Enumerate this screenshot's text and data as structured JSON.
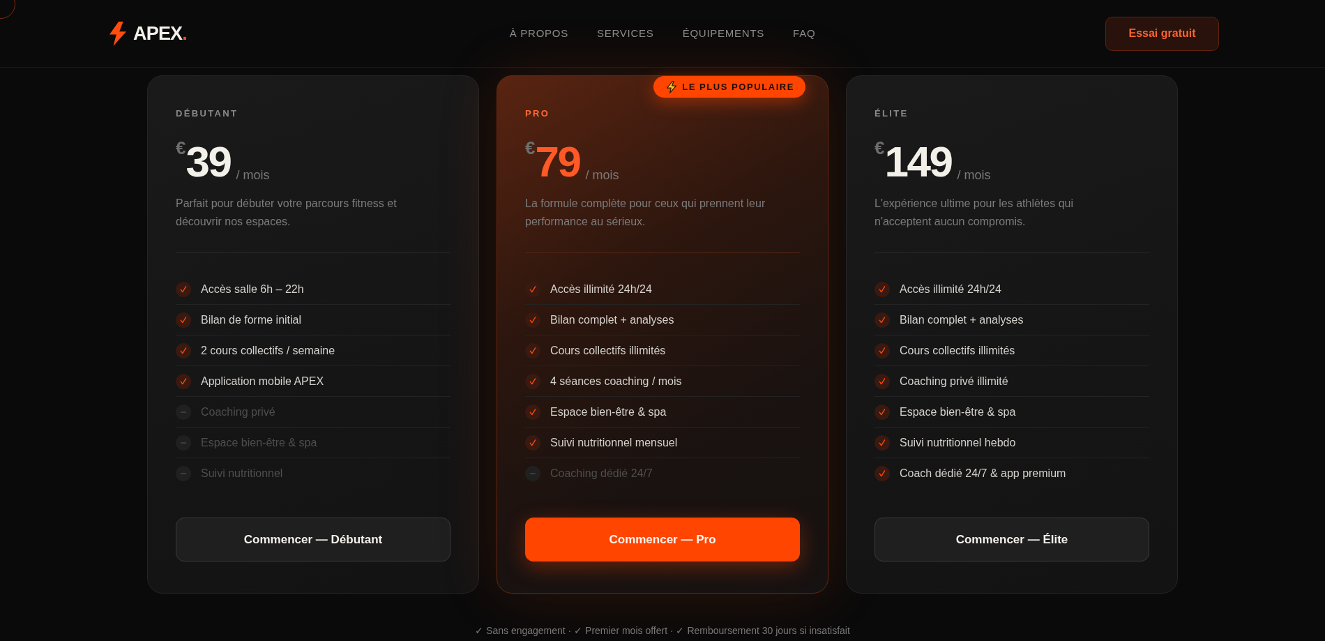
{
  "header": {
    "logo": {
      "name": "APEX",
      "mark": "."
    },
    "nav": [
      {
        "label": "À PROPOS"
      },
      {
        "label": "SERVICES"
      },
      {
        "label": "ÉQUIPEMENTS"
      },
      {
        "label": "FAQ"
      }
    ],
    "cta": "Essai gratuit"
  },
  "plans": [
    {
      "name": "DÉBUTANT",
      "featured": false,
      "currency": "€",
      "price": "39",
      "period": "/ mois",
      "description": "Parfait pour débuter votre parcours fitness et découvrir nos espaces.",
      "features": [
        {
          "label": "Accès salle 6h – 22h",
          "included": true
        },
        {
          "label": "Bilan de forme initial",
          "included": true
        },
        {
          "label": "2 cours collectifs / semaine",
          "included": true
        },
        {
          "label": "Application mobile APEX",
          "included": true
        },
        {
          "label": "Coaching privé",
          "included": false
        },
        {
          "label": "Espace bien-être & spa",
          "included": false
        },
        {
          "label": "Suivi nutritionnel",
          "included": false
        }
      ],
      "button": "Commencer — Débutant"
    },
    {
      "name": "PRO",
      "featured": true,
      "badge": "LE PLUS POPULAIRE",
      "currency": "€",
      "price": "79",
      "period": "/ mois",
      "description": "La formule complète pour ceux qui prennent leur performance au sérieux.",
      "features": [
        {
          "label": "Accès illimité 24h/24",
          "included": true
        },
        {
          "label": "Bilan complet + analyses",
          "included": true
        },
        {
          "label": "Cours collectifs illimités",
          "included": true
        },
        {
          "label": "4 séances coaching / mois",
          "included": true
        },
        {
          "label": "Espace bien-être & spa",
          "included": true
        },
        {
          "label": "Suivi nutritionnel mensuel",
          "included": true
        },
        {
          "label": "Coaching dédié 24/7",
          "included": false
        }
      ],
      "button": "Commencer — Pro"
    },
    {
      "name": "ÉLITE",
      "featured": false,
      "currency": "€",
      "price": "149",
      "period": "/ mois",
      "description": "L'expérience ultime pour les athlètes qui n'acceptent aucun compromis.",
      "features": [
        {
          "label": "Accès illimité 24h/24",
          "included": true
        },
        {
          "label": "Bilan complet + analyses",
          "included": true
        },
        {
          "label": "Cours collectifs illimités",
          "included": true
        },
        {
          "label": "Coaching privé illimité",
          "included": true
        },
        {
          "label": "Espace bien-être & spa",
          "included": true
        },
        {
          "label": "Suivi nutritionnel hebdo",
          "included": true
        },
        {
          "label": "Coach dédié 24/7 & app premium",
          "included": true
        }
      ],
      "button": "Commencer — Élite"
    }
  ],
  "footer_note": "✓ Sans engagement · ✓ Premier mois offert · ✓ Remboursement 30 jours si insatisfait"
}
